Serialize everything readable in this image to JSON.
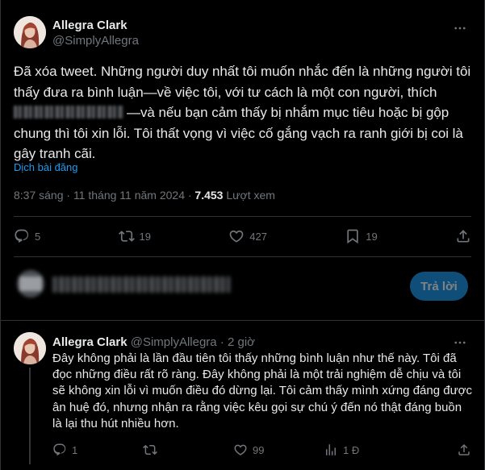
{
  "tweet": {
    "author": {
      "name": "Allegra Clark",
      "handle": "@SimplyAllegra"
    },
    "text_before": "Đã xóa tweet. Những người duy nhất tôi muốn nhắc đến là những người tôi thấy đưa ra bình luận—về việc tôi, với tư cách là một con người, thích ",
    "text_after": "—và nếu bạn cảm thấy bị nhắm mục tiêu hoặc bị gộp chung thì tôi xin lỗi. Tôi thất vọng vì việc cố gắng vạch ra ranh giới bị coi là gây tranh cãi.",
    "translate_label": "Dịch bài đăng",
    "timestamp": "8:37 sáng · 11 tháng 11 năm 2024 · ",
    "views_count": "7.453",
    "views_label": " Lượt xem",
    "actions": {
      "replies": "5",
      "reposts": "19",
      "likes": "427",
      "bookmarks": "19"
    }
  },
  "composer": {
    "reply_button_label": "Trả lời"
  },
  "reply": {
    "author": {
      "name": "Allegra Clark",
      "handle": "@SimplyAllegra",
      "age": " · 2 giờ"
    },
    "text": "Đây không phải là lần đầu tiên tôi thấy những bình luận như thế này. Tôi đã đọc những điều rất rõ ràng. Đây không phải là một trải nghiệm dễ chịu và tôi sẽ không xin lỗi vì muốn điều đó dừng lại. Tôi cảm thấy mình xứng đáng được ân huệ đó, nhưng nhận ra rằng việc kêu gọi sự chú ý đến nó thật đáng buồn là lại thu hút nhiều hơn.",
    "actions": {
      "replies": "1",
      "reposts": "",
      "likes": "99",
      "views": "1 Đ"
    }
  },
  "icons": [
    "more-icon",
    "reply-icon",
    "repost-icon",
    "like-icon",
    "bookmark-icon",
    "share-icon",
    "views-icon"
  ],
  "colors": {
    "background": "#000000",
    "text": "#e7e9ea",
    "muted": "#71767b",
    "accent": "#1d9bf0",
    "border": "#2f3336",
    "reply_button": "#0f4e78"
  }
}
